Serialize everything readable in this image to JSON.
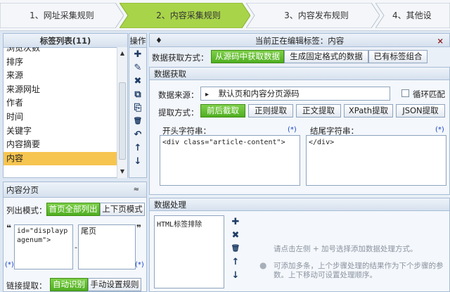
{
  "wizard": {
    "steps": [
      {
        "label": "1、网址采集规则"
      },
      {
        "label": "2、内容采集规则"
      },
      {
        "label": "3、内容发布规则"
      },
      {
        "label": "4、其他设"
      }
    ],
    "colors": {
      "active": "#a8d44a",
      "inactive": "#f4f6f9"
    }
  },
  "tag_list": {
    "title": "标签列表(11)",
    "items": [
      "浏览次数",
      "排序",
      "来源",
      "来源网址",
      "作者",
      "时间",
      "关键字",
      "内容摘要",
      "内容"
    ],
    "selected": "内容"
  },
  "ops": {
    "title": "操作",
    "icons": [
      "plus-icon",
      "edit-icon",
      "delete-icon",
      "copy-icon",
      "paste-icon",
      "trash-icon",
      "undo-icon",
      "arrow-up-icon",
      "arrow-down-icon"
    ],
    "glyphs": [
      "✚",
      "✎",
      "✖",
      "⧉",
      "⎘",
      "🗑",
      "↶",
      "↑",
      "↓"
    ]
  },
  "editing": {
    "label": "当前正在编辑标签：内容",
    "close": "×",
    "pin": "♦"
  },
  "fetch_mode": {
    "label": "数据获取方式：",
    "options": [
      "从源码中获取数据",
      "生成固定格式的数据",
      "已有标签组合"
    ],
    "selected": "从源码中获取数据"
  },
  "data_fetch": {
    "title": "数据获取",
    "source_label": "数据来源：",
    "source_value": "默认页和内容分页源码",
    "source_arrow": "▸",
    "loop_label": "循环匹配",
    "method_label": "提取方式：",
    "methods": [
      "前后截取",
      "正则提取",
      "正文提取",
      "XPath提取",
      "JSON提取"
    ],
    "method_selected": "前后截取",
    "start_label": "开头字符串：",
    "start_value": "<div class=\"article-content\">",
    "end_label": "结尾字符串：",
    "end_value": "</div>",
    "star_mark": "(*)"
  },
  "processing": {
    "title": "数据处理",
    "items": [
      "HTML标签排除"
    ],
    "icons": [
      "plus-icon",
      "delete-icon",
      "trash-icon",
      "arrow-up-icon",
      "arrow-down-icon"
    ],
    "glyphs": [
      "✚",
      "✖",
      "🗑",
      "↑",
      "↓"
    ],
    "hint1": "请点击左侧 + 加号选择添加数据处理方式。",
    "hint2": "可添加多条，上个步骤处理的结果作为下个步骤的参数。上下移动可设置处理顺序。",
    "info_icon": "●"
  },
  "paging": {
    "title": "内容分页",
    "collapse": "≈",
    "list_mode_label": "列出模式：",
    "list_modes": [
      "首页全部列出",
      "上下页模式"
    ],
    "list_mode_selected": "首页全部列出",
    "start_value": "id=\"displaypagenum\">",
    "end_value": "尾页",
    "dash": "-",
    "quote_open": "❝",
    "quote_close": "❞",
    "star_mark": "(*)",
    "link_label": "链接提取：",
    "link_modes": [
      "自动识别",
      "手动设置规则"
    ],
    "link_mode_selected": "自动识别"
  }
}
